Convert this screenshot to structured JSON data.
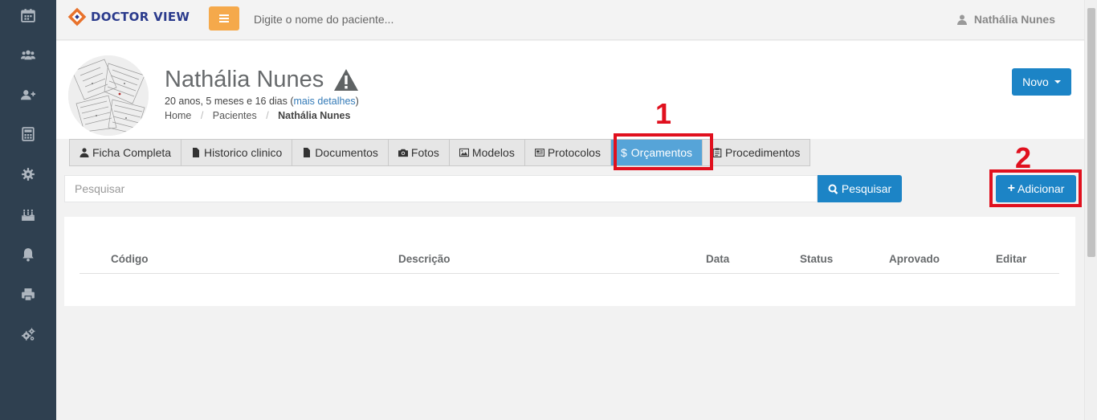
{
  "app": {
    "logo_text": "DOCTOR VIEW"
  },
  "topbar": {
    "search_placeholder": "Digite o nome do paciente...",
    "user_name": "Nathália Nunes"
  },
  "sidebar": {
    "items": [
      {
        "icon": "calendar-icon"
      },
      {
        "icon": "users-icon"
      },
      {
        "icon": "add-user-icon"
      },
      {
        "icon": "calculator-icon"
      },
      {
        "icon": "gear-icon"
      },
      {
        "icon": "cake-icon"
      },
      {
        "icon": "bell-icon"
      },
      {
        "icon": "printer-icon"
      },
      {
        "icon": "cogs-icon"
      }
    ]
  },
  "patient": {
    "name": "Nathália Nunes",
    "age_text": "20 anos, 5 meses e 16 dias (",
    "details_link": "mais detalhes",
    "age_close": ")",
    "warning_icon": "warning-icon"
  },
  "breadcrumb": {
    "items": [
      "Home",
      "Pacientes"
    ],
    "sep": "/",
    "current": "Nathália Nunes"
  },
  "actions": {
    "novo_label": "Novo"
  },
  "annotations": {
    "one": "1",
    "two": "2"
  },
  "tabs": [
    {
      "label": "Ficha Completa",
      "icon": "user-icon"
    },
    {
      "label": "Historico clinico",
      "icon": "file-icon"
    },
    {
      "label": "Documentos",
      "icon": "file-icon"
    },
    {
      "label": "Fotos",
      "icon": "camera-icon"
    },
    {
      "label": "Modelos",
      "icon": "image-icon"
    },
    {
      "label": "Protocolos",
      "icon": "newspaper-icon"
    },
    {
      "label": "Orçamentos",
      "icon": "dollar-icon",
      "active": true
    },
    {
      "label": "Procedimentos",
      "icon": "clipboard-icon"
    }
  ],
  "search": {
    "placeholder": "Pesquisar",
    "button_label": "Pesquisar",
    "add_label": "Adicionar",
    "dollar": "$",
    "plus": "+"
  },
  "table": {
    "columns": [
      "Código",
      "Descrição",
      "Data",
      "Status",
      "Aprovado",
      "Editar"
    ],
    "rows": []
  },
  "colors": {
    "sidebar": "#2f4050",
    "primary": "#1c84c6",
    "menu_button": "#f5a94b",
    "active_tab": "#56a4d8",
    "highlight": "#e0101e"
  }
}
